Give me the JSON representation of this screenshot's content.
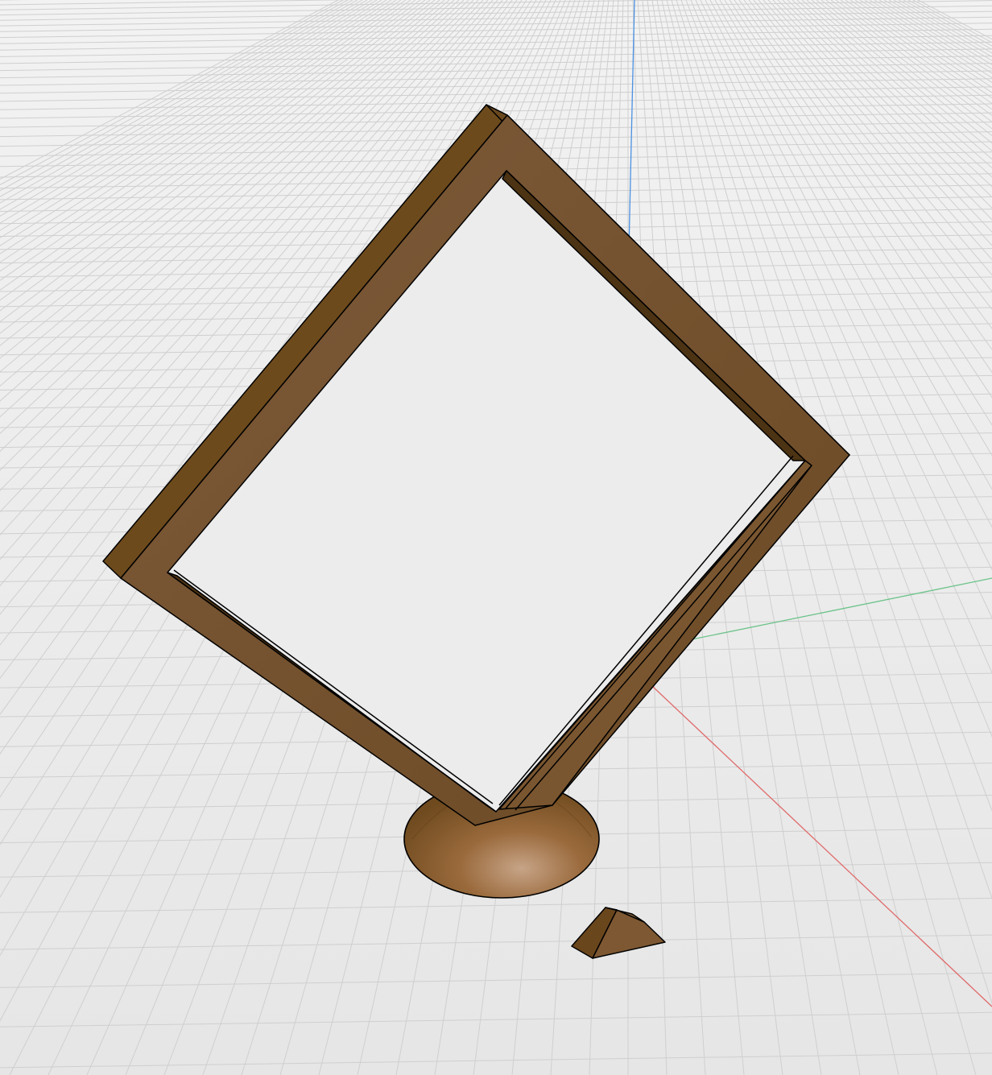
{
  "viewport": {
    "background_color": "#ececec",
    "grid_color": "#cfcfcf",
    "axis_colors": {
      "x": "#e06a6a",
      "y": "#6cc38a",
      "z": "#4a90e2"
    }
  },
  "scene": {
    "objects": [
      {
        "name": "picture-frame",
        "color": "#7a5634",
        "edge_color": "#000000"
      },
      {
        "name": "dome-base",
        "color": "#8a5a24"
      },
      {
        "name": "wedge-piece",
        "color": "#6f4a22"
      }
    ]
  }
}
